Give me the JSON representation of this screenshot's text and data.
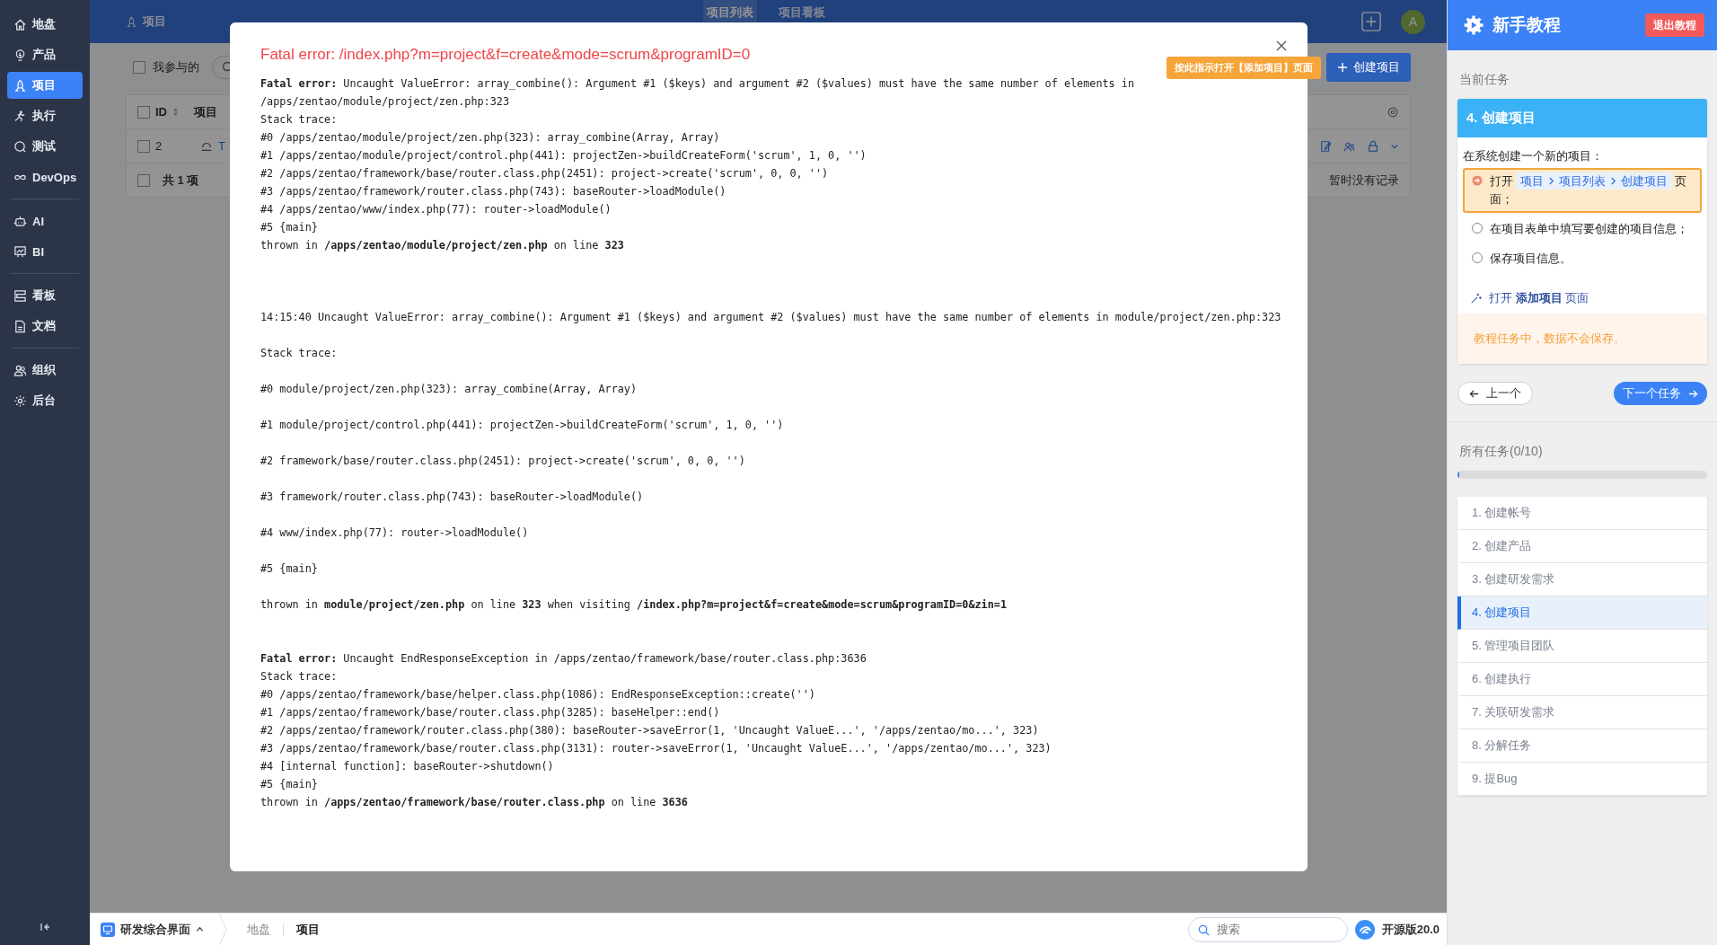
{
  "sidebar": {
    "groups": [
      {
        "items": [
          {
            "label": "地盘",
            "selected": false
          },
          {
            "label": "产品",
            "selected": false
          },
          {
            "label": "项目",
            "selected": true
          },
          {
            "label": "执行",
            "selected": false
          },
          {
            "label": "测试",
            "selected": false
          },
          {
            "label": "DevOps",
            "selected": false
          }
        ]
      },
      {
        "items": [
          {
            "label": "AI",
            "selected": false
          },
          {
            "label": "BI",
            "selected": false
          }
        ]
      },
      {
        "items": [
          {
            "label": "看板",
            "selected": false
          },
          {
            "label": "文档",
            "selected": false
          }
        ]
      },
      {
        "items": [
          {
            "label": "组织",
            "selected": false
          },
          {
            "label": "后台",
            "selected": false
          }
        ]
      }
    ]
  },
  "topbar": {
    "title": "项目",
    "tabs": [
      {
        "label": "项目列表",
        "selected": true
      },
      {
        "label": "项目看板",
        "selected": false
      }
    ],
    "avatar": "A"
  },
  "toolbar": {
    "filter": {
      "label": "我参与的",
      "checked": false
    },
    "create_button": "创建项目",
    "hint": "按此指示打开【添加项目】页面"
  },
  "table": {
    "header_checked": false,
    "footer_checked": false,
    "columns": [
      "ID",
      "项目"
    ],
    "rows": [
      {
        "id": "2",
        "name": "T",
        "checked": false
      }
    ],
    "footer": "共 1 项",
    "empty_note": "暂时没有记录"
  },
  "dialog": {
    "title": "Fatal error: /index.php?m=project&f=create&mode=scrum&programID=0",
    "blocks": [
      {
        "kind": "tight",
        "lines": [
          "**Fatal error:** Uncaught ValueError: array_combine(): Argument #1 ($keys) and argument #2 ($values) must have the same number of elements in",
          "/apps/zentao/module/project/zen.php:323",
          "Stack trace:",
          "#0 /apps/zentao/module/project/zen.php(323): array_combine(Array, Array)",
          "#1 /apps/zentao/module/project/control.php(441): projectZen->buildCreateForm('scrum', 1, 0, '')",
          "#2 /apps/zentao/framework/base/router.class.php(2451): project->create('scrum', 0, 0, '')",
          "#3 /apps/zentao/framework/router.class.php(743): baseRouter->loadModule()",
          "#4 /apps/zentao/www/index.php(77): router->loadModule()",
          "#5 {main}",
          "thrown in **/apps/zentao/module/project/zen.php** on line **323**"
        ]
      },
      {
        "kind": "wide",
        "lines": [
          "14:15:40 Uncaught ValueError: array_combine(): Argument #1 ($keys) and argument #2 ($values) must have the same number of elements in module/project/zen.php:323",
          "Stack trace:",
          "#0 module/project/zen.php(323): array_combine(Array, Array)",
          "#1 module/project/control.php(441): projectZen->buildCreateForm('scrum', 1, 0, '')",
          "#2 framework/base/router.class.php(2451): project->create('scrum', 0, 0, '')",
          "#3 framework/router.class.php(743): baseRouter->loadModule()",
          "#4 www/index.php(77): router->loadModule()",
          "#5 {main}",
          "thrown in **module/project/zen.php** on line **323** when visiting **/index.php?m=project&f=create&mode=scrum&programID=0&zin=1**"
        ]
      },
      {
        "kind": "tight",
        "lines": [
          "**Fatal error:** Uncaught EndResponseException in /apps/zentao/framework/base/router.class.php:3636",
          "Stack trace:",
          "#0 /apps/zentao/framework/base/helper.class.php(1086): EndResponseException::create('')",
          "#1 /apps/zentao/framework/base/router.class.php(3285): baseHelper::end()",
          "#2 /apps/zentao/framework/router.class.php(380): baseRouter->saveError(1, 'Uncaught ValueE...', '/apps/zentao/mo...', 323)",
          "#3 /apps/zentao/framework/base/router.class.php(3131): router->saveError(1, 'Uncaught ValueE...', '/apps/zentao/mo...', 323)",
          "#4 [internal function]: baseRouter->shutdown()",
          "#5 {main}",
          "thrown in **/apps/zentao/framework/base/router.class.php** on line **3636**"
        ]
      }
    ]
  },
  "tutorial": {
    "title": "新手教程",
    "exit_button": "退出教程",
    "current_label": "当前任务",
    "current_task": {
      "title": "4. 创建项目",
      "description": "在系统创建一个新的项目：",
      "steps": [
        {
          "kind": "nav",
          "current": true,
          "prefix": "打开",
          "path": [
            "项目",
            "项目列表",
            "创建项目"
          ],
          "suffix": "页面；"
        },
        {
          "kind": "text",
          "current": false,
          "text": "在项目表单中填写要创建的项目信息；"
        },
        {
          "kind": "text",
          "current": false,
          "text": "保存项目信息。"
        }
      ],
      "action_link": "打开 **添加项目** 页面",
      "warning": "教程任务中，数据不会保存。"
    },
    "prev_button": "上一个",
    "next_button": "下一个任务",
    "all_label": "所有任务(0/10)",
    "progress": {
      "level": 0.005
    },
    "tasks": [
      {
        "label": "1. 创建帐号",
        "selected": false
      },
      {
        "label": "2. 创建产品",
        "selected": false
      },
      {
        "label": "3. 创建研发需求",
        "selected": false
      },
      {
        "label": "4. 创建项目",
        "selected": true
      },
      {
        "label": "5. 管理项目团队",
        "selected": false
      },
      {
        "label": "6. 创建执行",
        "selected": false
      },
      {
        "label": "7. 关联研发需求",
        "selected": false
      },
      {
        "label": "8. 分解任务",
        "selected": false
      },
      {
        "label": "9. 提Bug",
        "selected": false
      }
    ]
  },
  "bottombar": {
    "app_switcher": "研发综合界面",
    "breadcrumbs": [
      {
        "label": "地盘",
        "selected": false
      },
      {
        "label": "项目",
        "selected": true
      }
    ],
    "search": {
      "placeholder": "搜索"
    },
    "version": "开源版20.0"
  }
}
